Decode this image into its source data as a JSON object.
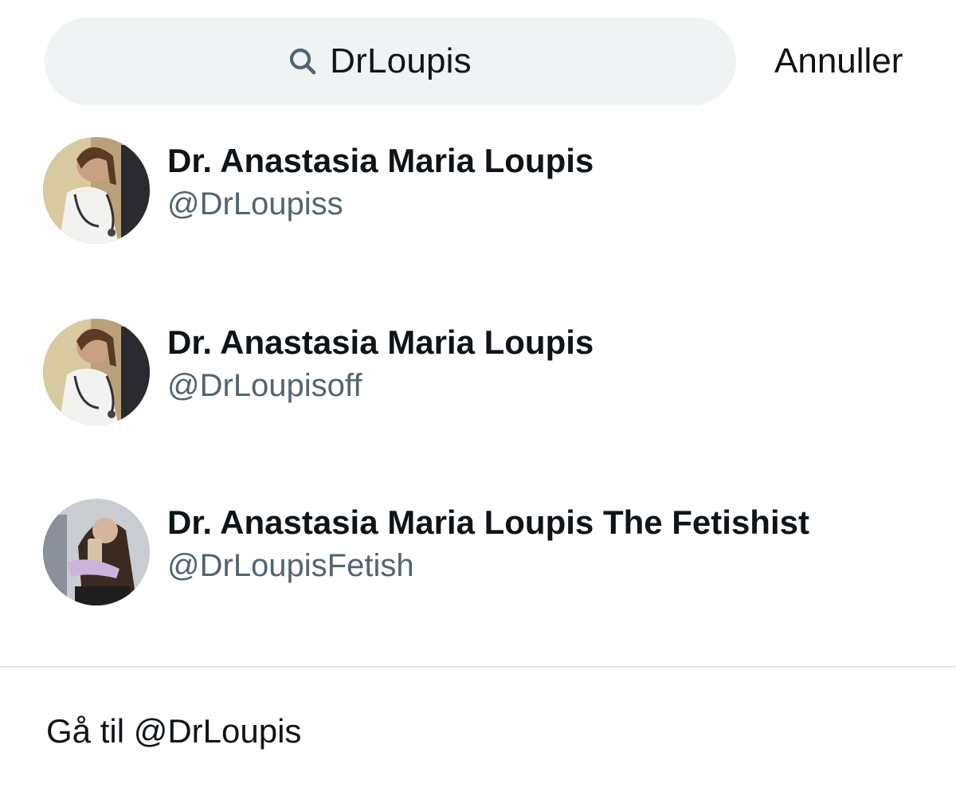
{
  "search": {
    "icon": "search-icon",
    "value": "DrLoupis"
  },
  "cancel_label": "Annuller",
  "results": [
    {
      "name": "Dr. Anastasia Maria Loupis",
      "handle": "@DrLoupiss",
      "avatar": "avatar-doctor-photo"
    },
    {
      "name": "Dr. Anastasia Maria Loupis",
      "handle": "@DrLoupisoff",
      "avatar": "avatar-doctor-photo"
    },
    {
      "name": "Dr. Anastasia Maria Loupis The Fetishist",
      "handle": "@DrLoupisFetish",
      "avatar": "avatar-selfie-photo"
    }
  ],
  "goto_label": "Gå til @DrLoupis",
  "colors": {
    "search_bg": "#eff3f4",
    "primary_text": "#0f1419",
    "secondary_text": "#536471",
    "divider": "#e1e6e8"
  }
}
